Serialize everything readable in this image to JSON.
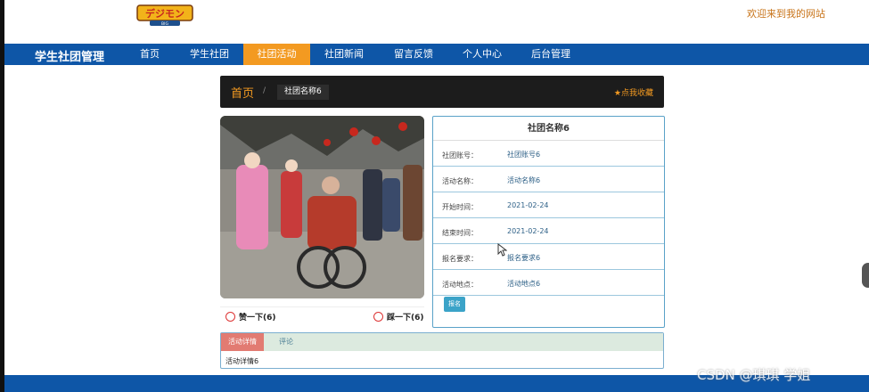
{
  "header": {
    "welcome": "欢迎来到我的网站",
    "logo_icon": "digimon-logo"
  },
  "nav": {
    "brand": "学生社团管理",
    "items": [
      {
        "label": "首页",
        "active": false
      },
      {
        "label": "学生社团",
        "active": false
      },
      {
        "label": "社团活动",
        "active": true
      },
      {
        "label": "社团新闻",
        "active": false
      },
      {
        "label": "留言反馈",
        "active": false
      },
      {
        "label": "个人中心",
        "active": false
      },
      {
        "label": "后台管理",
        "active": false
      }
    ],
    "bar_color": "#0e56a7",
    "active_color": "#f39a21"
  },
  "breadcrumb": {
    "home": "首页",
    "separator": "/",
    "current": "社团名称6",
    "favorite": "点我收藏",
    "favorite_icon": "star-icon"
  },
  "photo": {
    "icon": "event-photo"
  },
  "votes": {
    "like": "赞一下(6)",
    "dislike": "踩一下(6)"
  },
  "info": {
    "title": "社团名称6",
    "rows": [
      {
        "label": "社团账号：",
        "value": "社团账号6"
      },
      {
        "label": "活动名称：",
        "value": "活动名称6"
      },
      {
        "label": "开始时间：",
        "value": "2021-02-24"
      },
      {
        "label": "结束时间：",
        "value": "2021-02-24"
      },
      {
        "label": "报名要求：",
        "value": "报名要求6"
      },
      {
        "label": "活动地点：",
        "value": "活动地点6"
      }
    ],
    "apply_button": "报名"
  },
  "tabs": {
    "items": [
      "活动详情",
      "评论"
    ],
    "content": "活动详情6"
  },
  "watermark": "CSDN @琪琪 学姐"
}
